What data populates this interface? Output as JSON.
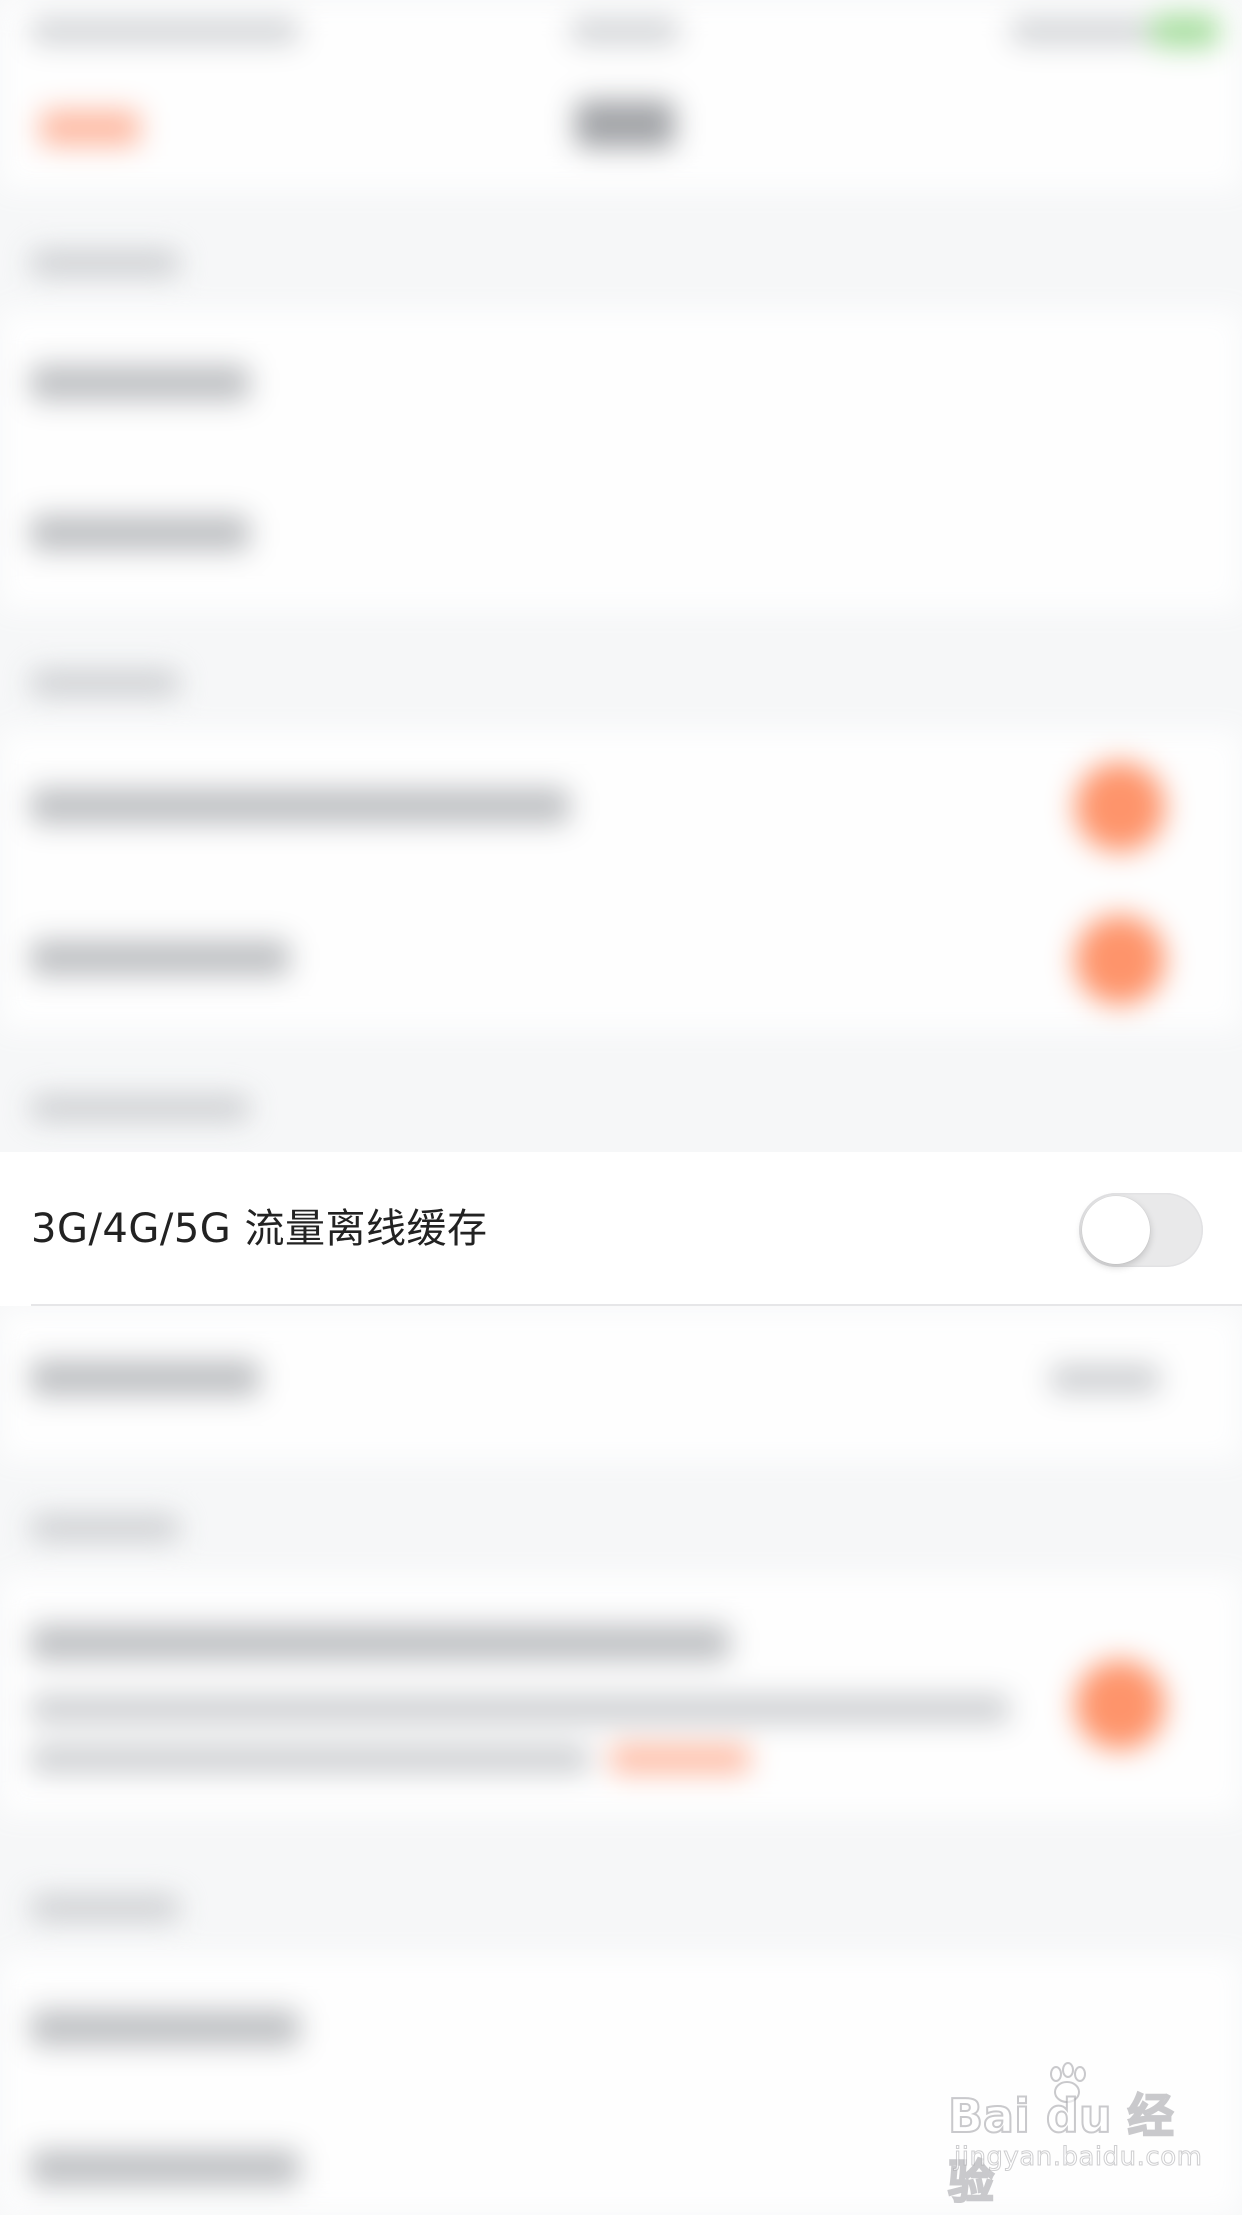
{
  "offline_cache_row": {
    "label": "3G/4G/5G 流量离线缓存",
    "toggle_on": false
  },
  "watermark": {
    "brand": "Bai du 经验",
    "url": "jingyan.baidu.com"
  },
  "colors": {
    "accent_orange": "#ff8a5c",
    "toggle_off_track": "#e9e9ea",
    "divider": "#e6e6e8",
    "text": "#222222"
  }
}
